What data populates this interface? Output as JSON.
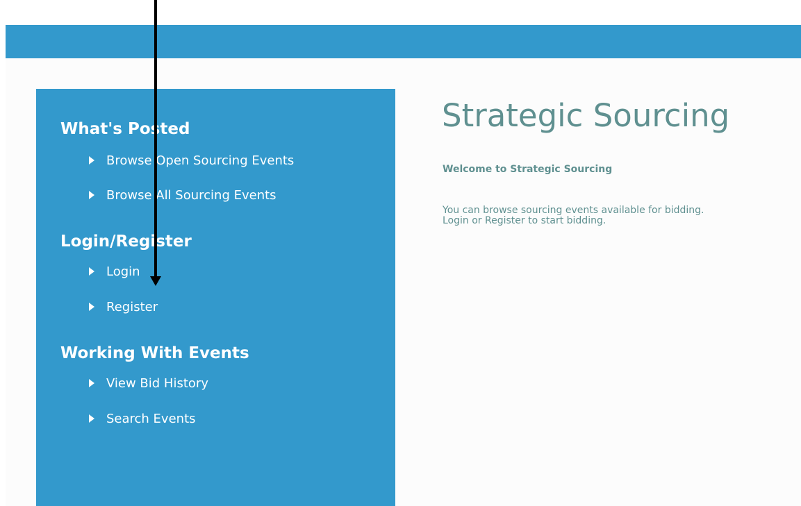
{
  "colors": {
    "primary_blue": "#3399cc",
    "teal_text": "#5f9090",
    "white": "#ffffff",
    "annotation_arrow": "#000000"
  },
  "sidebar": {
    "sections": [
      {
        "heading": "What's Posted",
        "items": [
          {
            "label": "Browse Open Sourcing Events",
            "icon": "arrow-right-icon"
          },
          {
            "label": "Browse All Sourcing Events",
            "icon": "arrow-right-icon"
          }
        ]
      },
      {
        "heading": "Login/Register",
        "items": [
          {
            "label": "Login",
            "icon": "arrow-right-icon"
          },
          {
            "label": "Register",
            "icon": "arrow-right-icon"
          }
        ]
      },
      {
        "heading": "Working With Events",
        "items": [
          {
            "label": "View Bid History",
            "icon": "arrow-right-icon"
          },
          {
            "label": "Search Events",
            "icon": "arrow-right-icon"
          }
        ]
      }
    ]
  },
  "main": {
    "title": "Strategic Sourcing",
    "welcome_heading": "Welcome to Strategic Sourcing",
    "welcome_text": "You can browse sourcing events available for bidding. Login or Register to start bidding."
  }
}
